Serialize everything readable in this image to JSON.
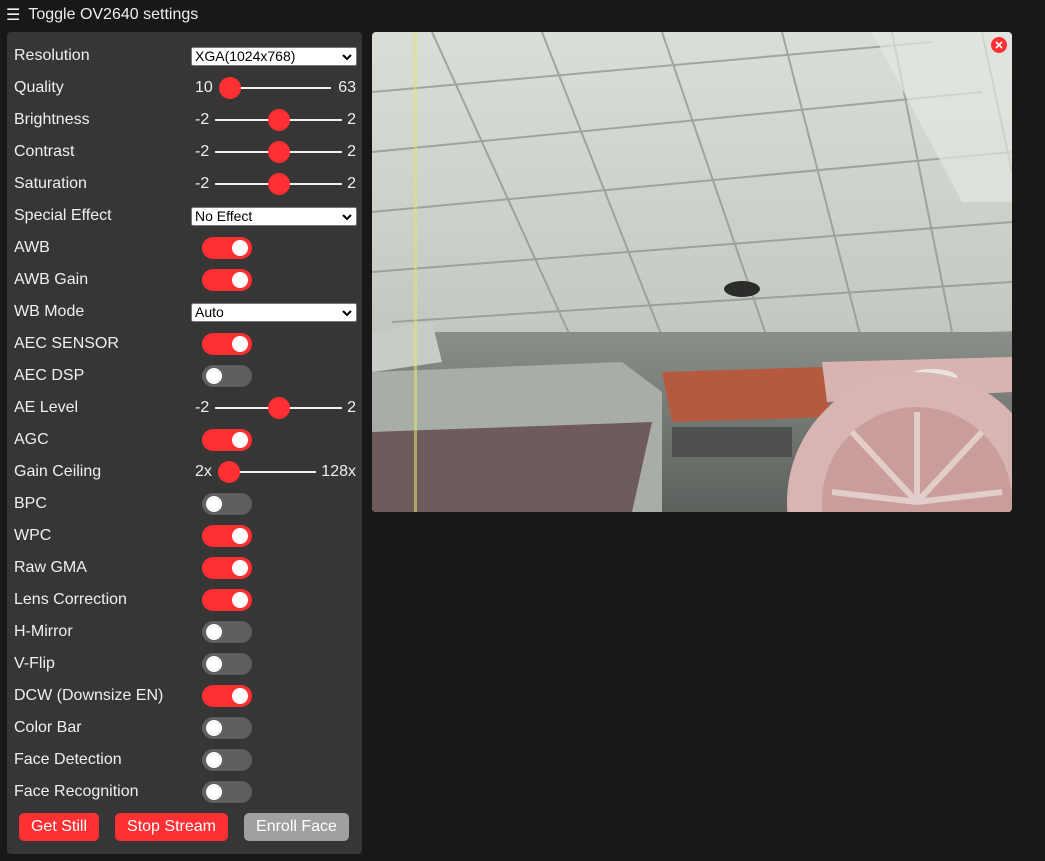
{
  "header": {
    "menu_icon": "hamburger-icon",
    "title": "Toggle OV2640 settings"
  },
  "settings": {
    "resolution": {
      "label": "Resolution",
      "value": "XGA(1024x768)"
    },
    "quality": {
      "label": "Quality",
      "min": "10",
      "max": "63",
      "value": 10
    },
    "brightness": {
      "label": "Brightness",
      "min": "-2",
      "max": "2",
      "value": 0
    },
    "contrast": {
      "label": "Contrast",
      "min": "-2",
      "max": "2",
      "value": 0
    },
    "saturation": {
      "label": "Saturation",
      "min": "-2",
      "max": "2",
      "value": 0
    },
    "special_effect": {
      "label": "Special Effect",
      "value": "No Effect"
    },
    "awb": {
      "label": "AWB",
      "on": true
    },
    "awb_gain": {
      "label": "AWB Gain",
      "on": true
    },
    "wb_mode": {
      "label": "WB Mode",
      "value": "Auto"
    },
    "aec_sensor": {
      "label": "AEC SENSOR",
      "on": true
    },
    "aec_dsp": {
      "label": "AEC DSP",
      "on": false
    },
    "ae_level": {
      "label": "AE Level",
      "min": "-2",
      "max": "2",
      "value": 0
    },
    "agc": {
      "label": "AGC",
      "on": true
    },
    "gain_ceiling": {
      "label": "Gain Ceiling",
      "min": "2x",
      "max": "128x",
      "value": "2x"
    },
    "bpc": {
      "label": "BPC",
      "on": false
    },
    "wpc": {
      "label": "WPC",
      "on": true
    },
    "raw_gma": {
      "label": "Raw GMA",
      "on": true
    },
    "lens_correction": {
      "label": "Lens Correction",
      "on": true
    },
    "h_mirror": {
      "label": "H-Mirror",
      "on": false
    },
    "v_flip": {
      "label": "V-Flip",
      "on": false
    },
    "dcw": {
      "label": "DCW (Downsize EN)",
      "on": true
    },
    "color_bar": {
      "label": "Color Bar",
      "on": false
    },
    "face_detection": {
      "label": "Face Detection",
      "on": false
    },
    "face_recognition": {
      "label": "Face Recognition",
      "on": false
    }
  },
  "buttons": {
    "get_still": "Get Still",
    "stop_stream": "Stop Stream",
    "enroll_face": "Enroll Face"
  },
  "stream": {
    "close_icon": "close-icon"
  },
  "colors": {
    "accent": "#ff3034",
    "background": "#181818",
    "panel": "#363636",
    "toggle_off": "#5f5f5f",
    "disabled_button": "#a0a0a0"
  }
}
